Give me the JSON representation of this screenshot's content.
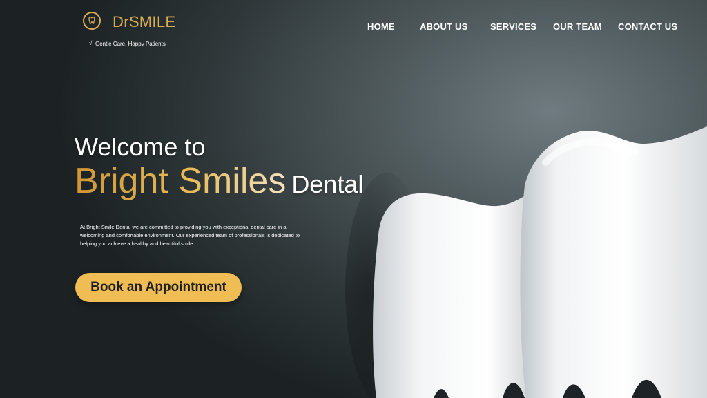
{
  "brand": {
    "name": "DrSMILE",
    "tagline": "Gentle Care, Happy Patients",
    "logo_icon": "tooth-smile-icon",
    "accent_color": "#d8ac55"
  },
  "nav": {
    "items": [
      {
        "label": "HOME"
      },
      {
        "label": "ABOUT US"
      },
      {
        "label": "SERVICES"
      },
      {
        "label": "OUR TEAM"
      },
      {
        "label": "CONTACT US"
      }
    ]
  },
  "hero": {
    "welcome": "Welcome to",
    "headline_gold": "Bright Smiles",
    "headline_white": "Dental",
    "description": "At Bright Smile Dental we are committed to providing you with exceptional dental care in a welcoming and comfortable environment. Our experienced team of professionals is dedicated to helping you achieve a healthy and beautiful smile",
    "cta_label": "Book an Appointment",
    "cta_color": "#f0bd54"
  }
}
